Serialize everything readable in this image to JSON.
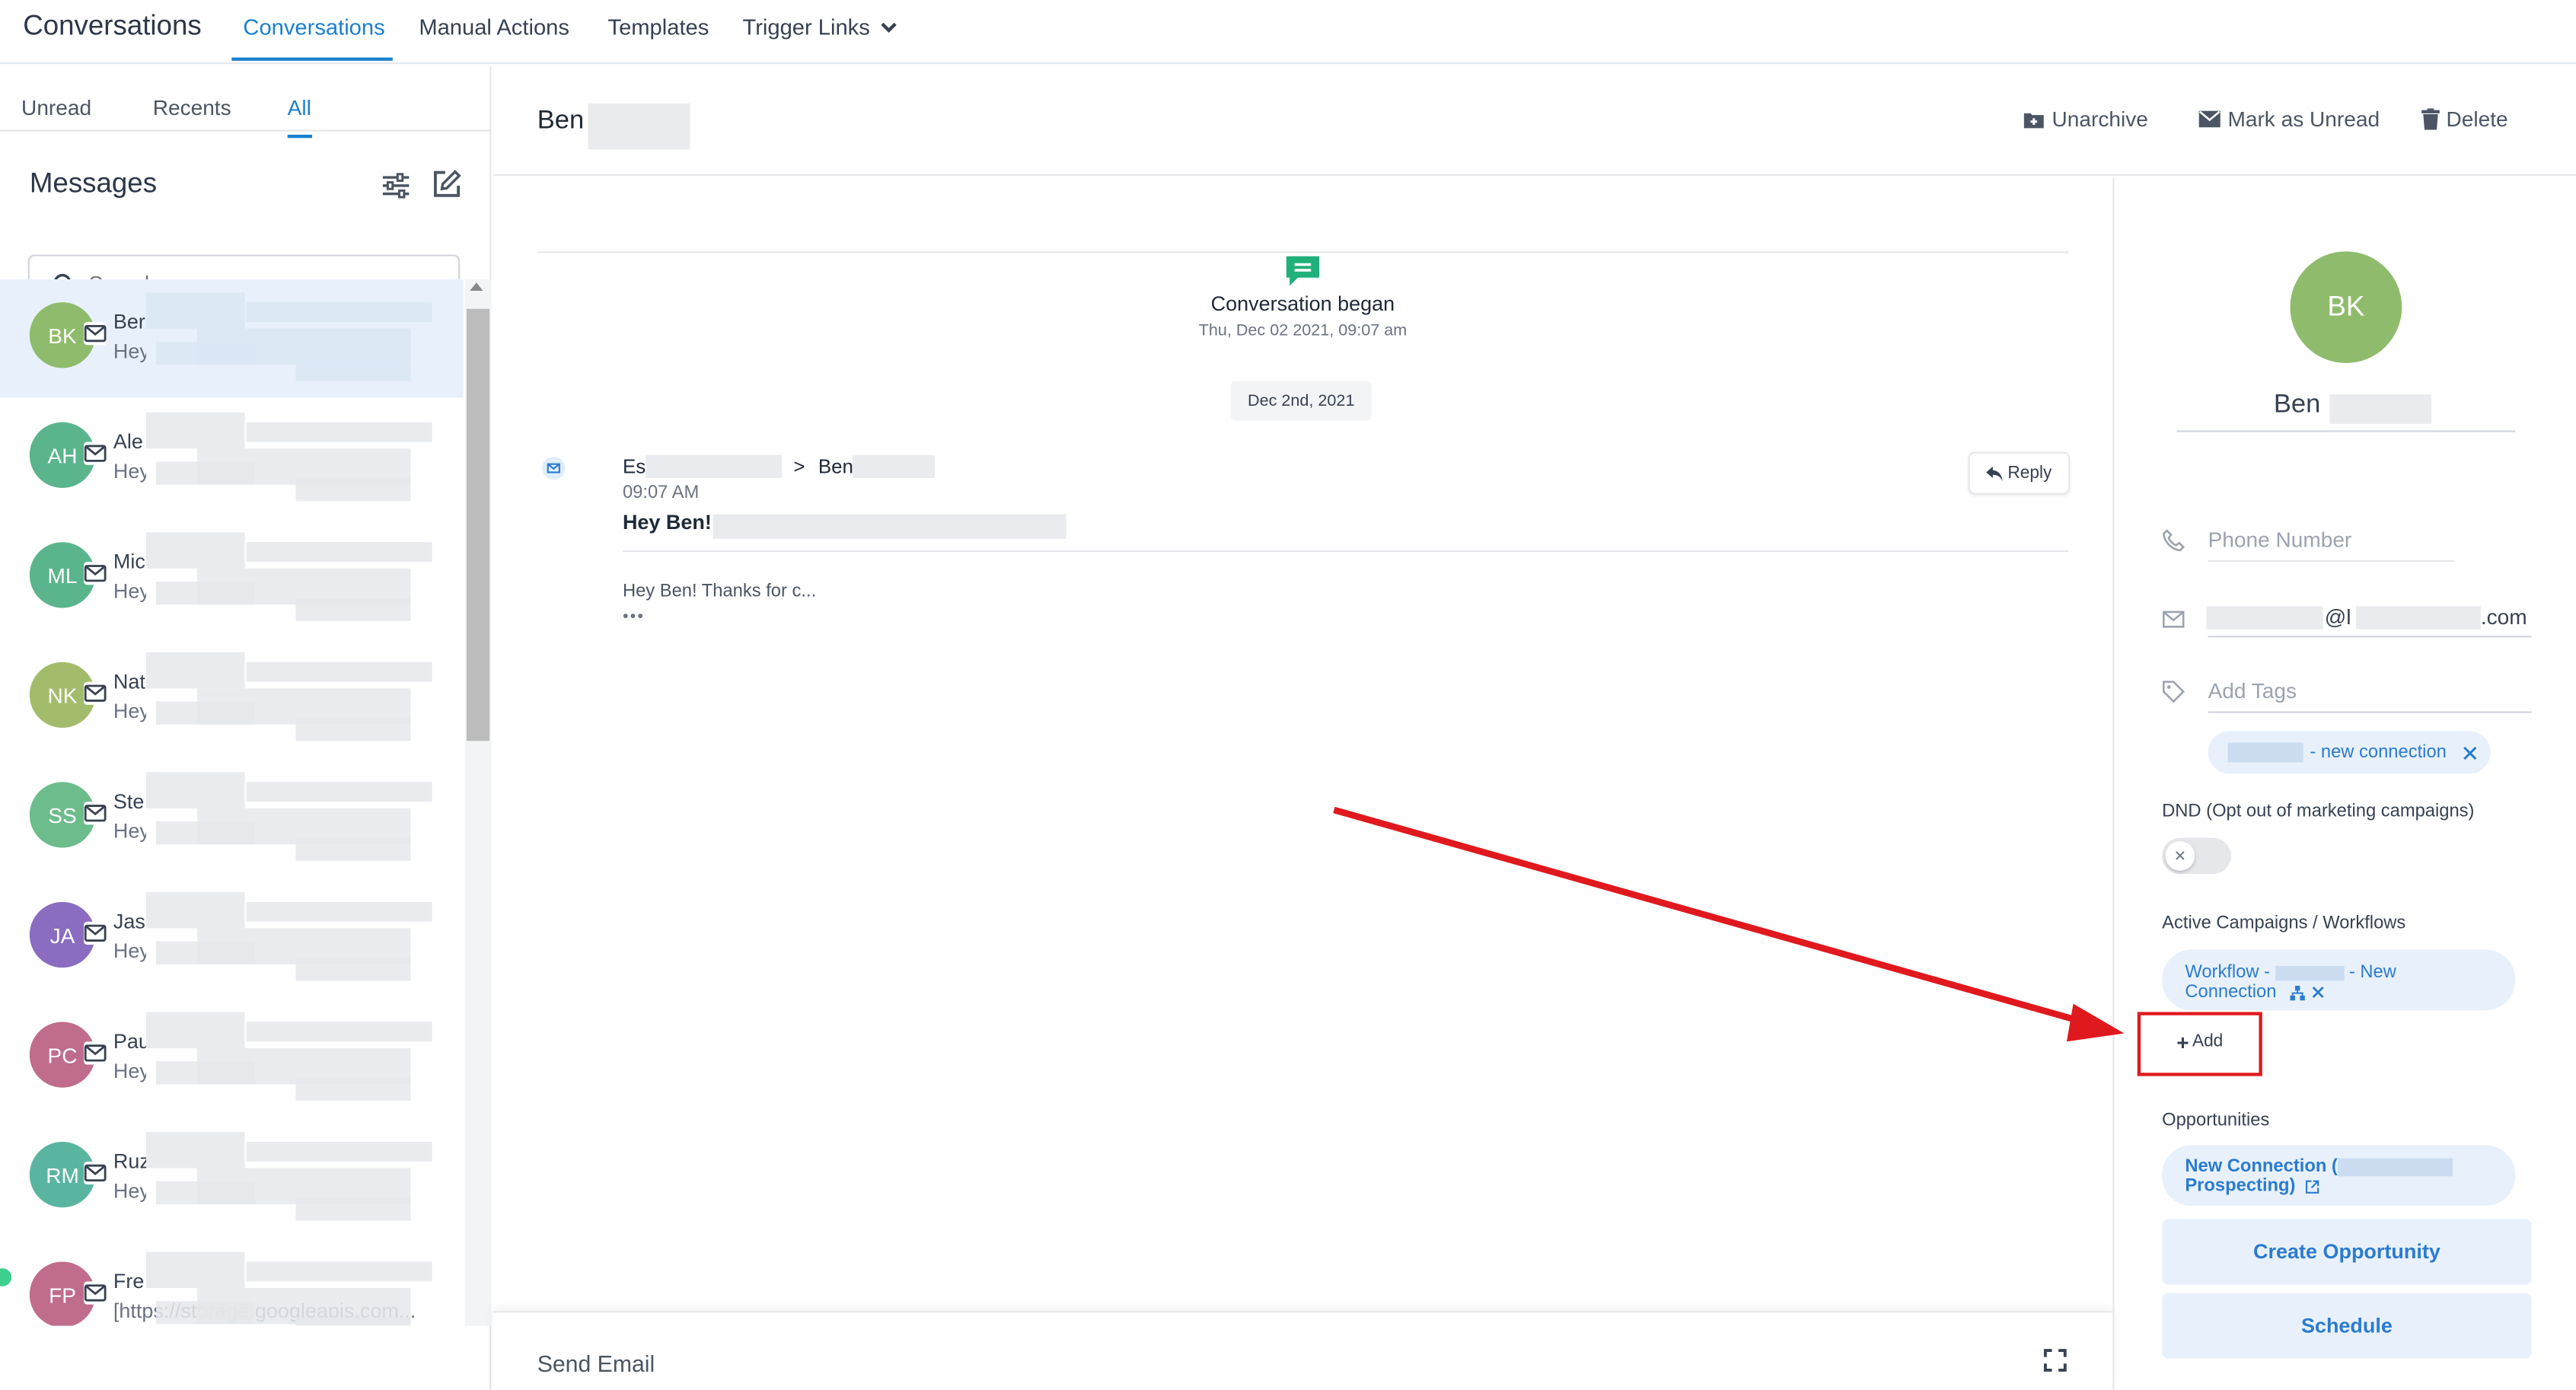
{
  "app": {
    "title": "Conversations"
  },
  "nav": {
    "tabs": [
      "Conversations",
      "Manual Actions",
      "Templates",
      "Trigger Links"
    ],
    "active": "Conversations"
  },
  "filters": {
    "tabs": [
      "Unread",
      "Recents",
      "All"
    ],
    "active": "All"
  },
  "messages_panel": {
    "title": "Messages",
    "search_placeholder": "Search"
  },
  "conversations": [
    {
      "initials": "BK",
      "name": "Ber",
      "preview": "Hey",
      "color": "#8fbc6c",
      "selected": true
    },
    {
      "initials": "AH",
      "name": "Ale",
      "preview": "Hey",
      "color": "#5ab58c",
      "selected": false
    },
    {
      "initials": "ML",
      "name": "Mic",
      "preview": "Hey",
      "color": "#5ab58c",
      "selected": false
    },
    {
      "initials": "NK",
      "name": "Nat",
      "preview": "Hey",
      "color": "#a3bc6c",
      "selected": false
    },
    {
      "initials": "SS",
      "name": "Ste",
      "preview": "Hey",
      "color": "#6cbc8c",
      "selected": false
    },
    {
      "initials": "JA",
      "name": "Jas",
      "preview": "Hey",
      "color": "#8a6cc0",
      "selected": false
    },
    {
      "initials": "PC",
      "name": "Pau",
      "preview": "Hey",
      "color": "#c06c8c",
      "selected": false
    },
    {
      "initials": "RM",
      "name": "Ruz",
      "preview": "Hey",
      "color": "#5ab5a0",
      "selected": false
    },
    {
      "initials": "FP",
      "name": "Fre",
      "preview": "[https://storage.googleapis.com...",
      "color": "#c06c8c",
      "selected": false
    }
  ],
  "conversation": {
    "contact_name": "Ben",
    "actions": [
      "Unarchive",
      "Mark as Unread",
      "Delete"
    ],
    "began_title": "Conversation began",
    "began_date": "Thu, Dec 02 2021, 09:07 am",
    "date_chip": "Dec 2nd, 2021",
    "message": {
      "from": "Es",
      "to": "Ben",
      "separator": ">",
      "time": "09:07 AM",
      "subject": "Hey Ben!",
      "body": "Hey Ben! Thanks for c...",
      "dots": "•••",
      "reply_label": "Reply"
    },
    "composer_label": "Send Email"
  },
  "contact": {
    "initials": "BK",
    "name": "Ben",
    "phone_placeholder": "Phone Number",
    "email_at": "@l",
    "email_suffix": ".com",
    "tags_placeholder": "Add Tags",
    "tag": "- new connection",
    "dnd_label": "DND (Opt out of marketing campaigns)",
    "campaigns_label": "Active Campaigns / Workflows",
    "workflow_prefix": "Workflow -",
    "workflow_suffix": "- New",
    "workflow_line2": "Connection",
    "add_label": "Add",
    "opportunities_label": "Opportunities",
    "opportunity_line1": "New Connection (",
    "opportunity_line2": "Prospecting)",
    "create_opportunity": "Create Opportunity",
    "schedule": "Schedule"
  },
  "colors": {
    "accent": "#1a7fd0",
    "highlight": "#e0191e",
    "chip_bg": "#e8f1fb",
    "avatar_contact": "#8fbc6c"
  }
}
